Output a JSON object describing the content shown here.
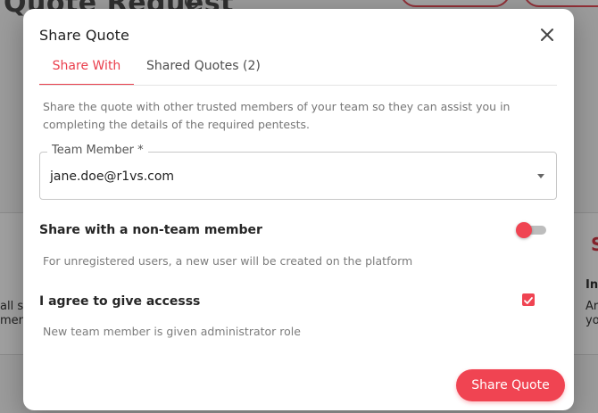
{
  "modal": {
    "title": "Share Quote",
    "tabs": [
      {
        "label": "Share With",
        "active": true
      },
      {
        "label": "Shared Quotes (2)",
        "active": false
      }
    ],
    "description": "Share the quote with other trusted members of your team so they can assist you in completing the details of the required pentests.",
    "team_member": {
      "label": "Team Member *",
      "value": "jane.doe@r1vs.com"
    },
    "non_team_member": {
      "label": "Share with a non-team member",
      "help": "For unregistered users, a new user will be created on the platform",
      "toggle_on": false
    },
    "agree": {
      "label": "I agree to give accesss",
      "help": "New team member is given administrator role",
      "checked": true
    },
    "submit_label": "Share Quote"
  },
  "background": {
    "page_title": "Quote Request",
    "fragments": {
      "left_a": "all se",
      "left_b": "ment",
      "right_a": "In",
      "right_b": "Ar",
      "right_c": "yo"
    }
  },
  "icons": {
    "close": "close-icon",
    "dropdown": "chevron-down-icon",
    "checkmark": "check-icon"
  },
  "colors": {
    "accent": "#f04452",
    "tab_active": "#ea3e4c"
  }
}
